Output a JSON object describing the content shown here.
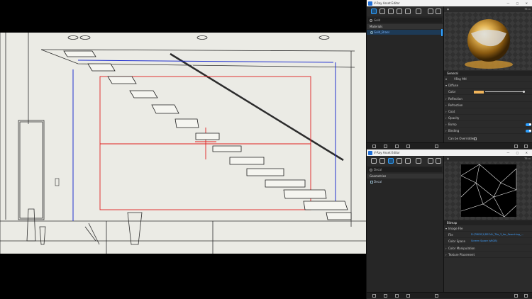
{
  "viewport": {
    "label": "3D viewport wireframe",
    "colors": {
      "background": "#ebebe5",
      "lines": "#2c2c2c",
      "red_frame": "#e02020",
      "blue_frame": "#2030d0"
    }
  },
  "editor1": {
    "title": "V-Ray Asset Editor",
    "window_controls": "—  ▢  ✕",
    "search": {
      "value": "Gold",
      "placeholder": "Search"
    },
    "section": "Materials",
    "items": [
      {
        "label": "Gold_Brass",
        "selected": true
      }
    ],
    "preview_toolbar": "75  ▭",
    "properties": {
      "header": "General",
      "material_type": "VRay Mtl",
      "diffuse_label": "Diffuse",
      "color_label": "Color",
      "rollouts": [
        "Reflection",
        "Refraction",
        "Coat",
        "Opacity",
        "Bump",
        "Binding"
      ],
      "bump_on": true,
      "binding_on": true,
      "footer_label": "Can be Overridden"
    },
    "accent_color": "#f0b45a"
  },
  "editor2": {
    "title": "V-Ray Asset Editor",
    "window_controls": "—  ▢  ✕",
    "search": {
      "value": "Decal",
      "placeholder": "Search"
    },
    "section": "Geometries",
    "items": [
      {
        "label": "Decal",
        "selected": false
      }
    ],
    "preview_toolbar": "75  ▭",
    "properties": {
      "header": "Bitmap",
      "image_file_label": "Image File",
      "file_label": "File",
      "file_value": "D:\\TMDS\\1\\DECAL_Tile_3_for_Searching_…",
      "color_space_label": "Color Space",
      "color_space_value": "Screen Space (sRGB)",
      "rollouts": [
        "Color Manipulation",
        "Texture Placement"
      ]
    }
  },
  "icons": {
    "toolbar": [
      "materials-icon",
      "lights-icon",
      "geometry-icon",
      "textures-icon",
      "render-elements-icon",
      "settings-icon",
      "teapot-icon",
      "frame-buffer-icon"
    ],
    "bottom": [
      "add-icon",
      "open-icon",
      "save-icon",
      "delete-icon",
      "purge-icon"
    ]
  }
}
